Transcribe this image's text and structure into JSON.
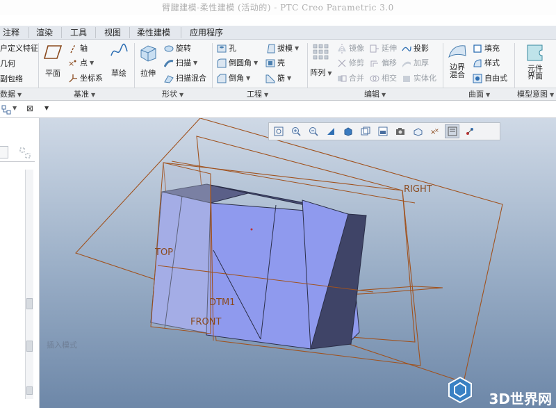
{
  "window": {
    "title": "臂腱建模-柔性建模 (活动的) - PTC Creo Parametric 3.0"
  },
  "tabs": [
    "注释",
    "渲染",
    "工具",
    "视图",
    "柔性建模",
    "应用程序"
  ],
  "ribbon": {
    "datum_left": {
      "items": [
        "户定义特征",
        "几何",
        "副包络"
      ]
    },
    "datum": {
      "plane": "平面",
      "axis": "轴",
      "point": "点",
      "csys": "坐标系",
      "sketch": "草绘"
    },
    "shapes": {
      "extrude": "拉伸",
      "revolve": "旋转",
      "sweep": "扫描",
      "swept_blend": "扫描混合"
    },
    "engineering": {
      "hole": "孔",
      "round": "倒圆角",
      "chamfer": "倒角",
      "draft": "拔模",
      "shell": "壳",
      "rib": "筋"
    },
    "editing": {
      "pattern": "阵列",
      "mirror": "镜像",
      "extend": "延伸",
      "project": "投影",
      "trim": "修剪",
      "offset": "偏移",
      "thicken": "加厚",
      "merge": "合并",
      "intersect": "相交",
      "solidify": "实体化"
    },
    "surfaces": {
      "fill": "填充",
      "boundary_blend_1": "边界",
      "boundary_blend_2": "混合",
      "style": "样式",
      "freestyle": "自由式"
    },
    "model_intent": {
      "component_interface_1": "元件",
      "component_interface_2": "界面"
    }
  },
  "group_labels": [
    "数据",
    "基准",
    "形状",
    "工程",
    "编辑",
    "曲面",
    "模型意图"
  ],
  "viewport": {
    "datum_labels": [
      "RIGHT",
      "TOP",
      "DTM1",
      "FRONT"
    ],
    "mode_text": "插入模式",
    "watermark": "3D世界网"
  },
  "colors": {
    "datum_plane": "#a0521e",
    "part_face": "#8f9aee",
    "part_dark": "#3f4467",
    "viewport_top": "#cfd9e6",
    "viewport_bottom": "#6d87a8"
  }
}
